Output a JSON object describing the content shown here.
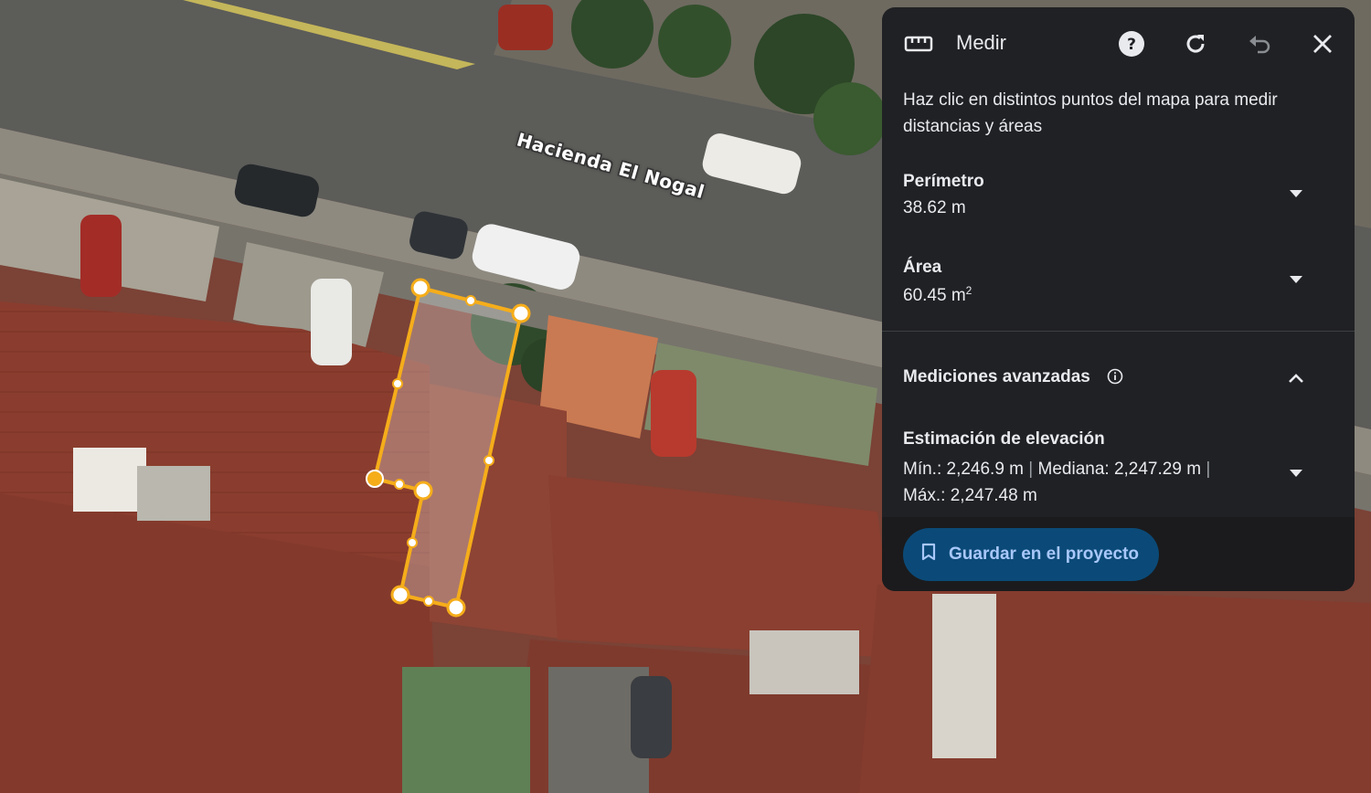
{
  "map": {
    "street_name": "Hacienda El Nogal",
    "colors": {
      "road": "#5b5b58",
      "sidewalk": "#8f8b82",
      "roof": "#8b3e2f",
      "measure_line": "#f5ad1a"
    }
  },
  "panel": {
    "title": "Medir",
    "icons": [
      "ruler-icon",
      "help-icon",
      "refresh-icon",
      "undo-icon",
      "close-icon"
    ],
    "instructions": "Haz clic en distintos puntos del mapa para medir distancias y áreas",
    "perimeter": {
      "label": "Perímetro",
      "value": "38.62 m"
    },
    "area": {
      "label": "Área",
      "value": "60.45 m",
      "unit_superscript": "2"
    },
    "advanced": {
      "label": "Mediciones avanzadas"
    },
    "elevation": {
      "label": "Estimación de elevación",
      "min": "Mín.: 2,246.9 m",
      "median": "Mediana: 2,247.29 m",
      "max": "Máx.: 2,247.48 m",
      "separator": "|"
    },
    "save_button": "Guardar en el proyecto"
  }
}
